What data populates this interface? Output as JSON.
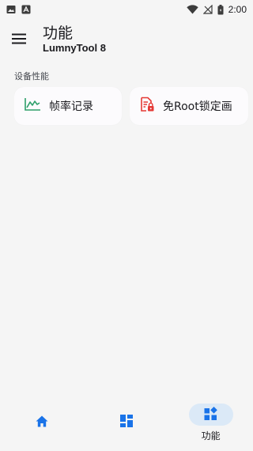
{
  "status_bar": {
    "time": "2:00",
    "icons": [
      "image-icon",
      "android-icon",
      "wifi-icon",
      "no-signal-icon",
      "battery-icon"
    ]
  },
  "app_bar": {
    "title": "功能",
    "subtitle": "LumnyTool 8",
    "menu_icon": "menu-icon"
  },
  "section": {
    "label": "设备性能",
    "cards": [
      {
        "label": "帧率记录",
        "icon": "line-chart-icon",
        "color": "#2e9f6a"
      },
      {
        "label": "免Root锁定画",
        "icon": "locked-document-icon",
        "color": "#e53935"
      }
    ]
  },
  "bottom_nav": {
    "accent": "#1a73e8",
    "active_bg": "#dbe9f7",
    "items": [
      {
        "icon": "home-icon",
        "label": ""
      },
      {
        "icon": "dashboard-icon",
        "label": ""
      },
      {
        "icon": "widgets-icon",
        "label": "功能",
        "active": true
      }
    ]
  }
}
